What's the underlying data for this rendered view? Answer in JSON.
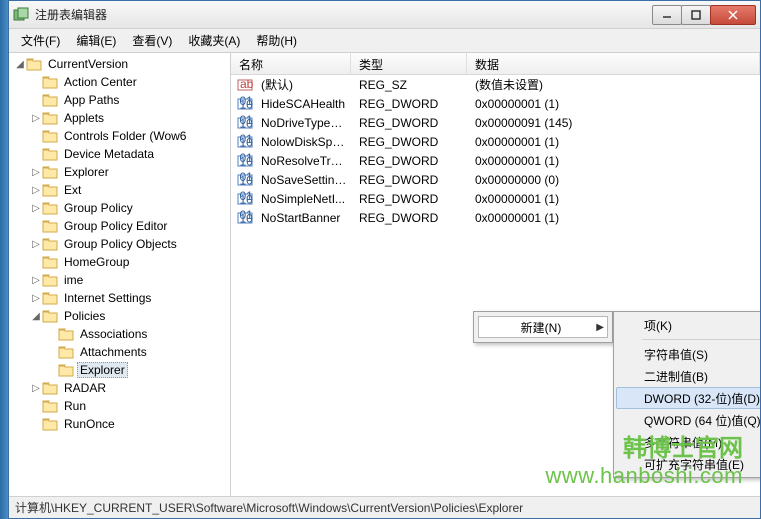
{
  "window": {
    "title": "注册表编辑器"
  },
  "menu": [
    "文件(F)",
    "编辑(E)",
    "查看(V)",
    "收藏夹(A)",
    "帮助(H)"
  ],
  "tree": {
    "root": {
      "label": "CurrentVersion",
      "toggle": "◢",
      "children": [
        {
          "label": "Action Center"
        },
        {
          "label": "App Paths"
        },
        {
          "label": "Applets",
          "toggle": "▷"
        },
        {
          "label": "Controls Folder (Wow6"
        },
        {
          "label": "Device Metadata"
        },
        {
          "label": "Explorer",
          "toggle": "▷"
        },
        {
          "label": "Ext",
          "toggle": "▷"
        },
        {
          "label": "Group Policy",
          "toggle": "▷"
        },
        {
          "label": "Group Policy Editor"
        },
        {
          "label": "Group Policy Objects",
          "toggle": "▷"
        },
        {
          "label": "HomeGroup"
        },
        {
          "label": "ime",
          "toggle": "▷"
        },
        {
          "label": "Internet Settings",
          "toggle": "▷"
        },
        {
          "label": "Policies",
          "toggle": "◢",
          "children": [
            {
              "label": "Associations"
            },
            {
              "label": "Attachments"
            },
            {
              "label": "Explorer",
              "selected": true
            }
          ]
        },
        {
          "label": "RADAR",
          "toggle": "▷"
        },
        {
          "label": "Run"
        },
        {
          "label": "RunOnce"
        }
      ]
    }
  },
  "list": {
    "headers": [
      "名称",
      "类型",
      "数据"
    ],
    "rows": [
      {
        "icon": "ab",
        "name": "(默认)",
        "type": "REG_SZ",
        "data": "(数值未设置)"
      },
      {
        "icon": "bin",
        "name": "HideSCAHealth",
        "type": "REG_DWORD",
        "data": "0x00000001 (1)"
      },
      {
        "icon": "bin",
        "name": "NoDriveTypeA...",
        "type": "REG_DWORD",
        "data": "0x00000091 (145)"
      },
      {
        "icon": "bin",
        "name": "NolowDiskSpa...",
        "type": "REG_DWORD",
        "data": "0x00000001 (1)"
      },
      {
        "icon": "bin",
        "name": "NoResolveTrack",
        "type": "REG_DWORD",
        "data": "0x00000001 (1)"
      },
      {
        "icon": "bin",
        "name": "NoSaveSettings",
        "type": "REG_DWORD",
        "data": "0x00000000 (0)"
      },
      {
        "icon": "bin",
        "name": "NoSimpleNetI...",
        "type": "REG_DWORD",
        "data": "0x00000001 (1)"
      },
      {
        "icon": "bin",
        "name": "NoStartBanner",
        "type": "REG_DWORD",
        "data": "0x00000001 (1)"
      }
    ]
  },
  "contextMenu": {
    "label": "新建(N)"
  },
  "submenu": [
    {
      "label": "项(K)"
    },
    {
      "sep": true
    },
    {
      "label": "字符串值(S)"
    },
    {
      "label": "二进制值(B)"
    },
    {
      "label": "DWORD (32-位)值(D)",
      "hi": true
    },
    {
      "label": "QWORD (64 位)值(Q)"
    },
    {
      "label": "多字符串值(M)"
    },
    {
      "label": "可扩充字符串值(E)"
    }
  ],
  "status": {
    "path": "计算机\\HKEY_CURRENT_USER\\Software\\Microsoft\\Windows\\CurrentVersion\\Policies\\Explorer"
  },
  "watermark": {
    "line1": "韩博士官网",
    "line2": "www.hanboshi.com"
  }
}
